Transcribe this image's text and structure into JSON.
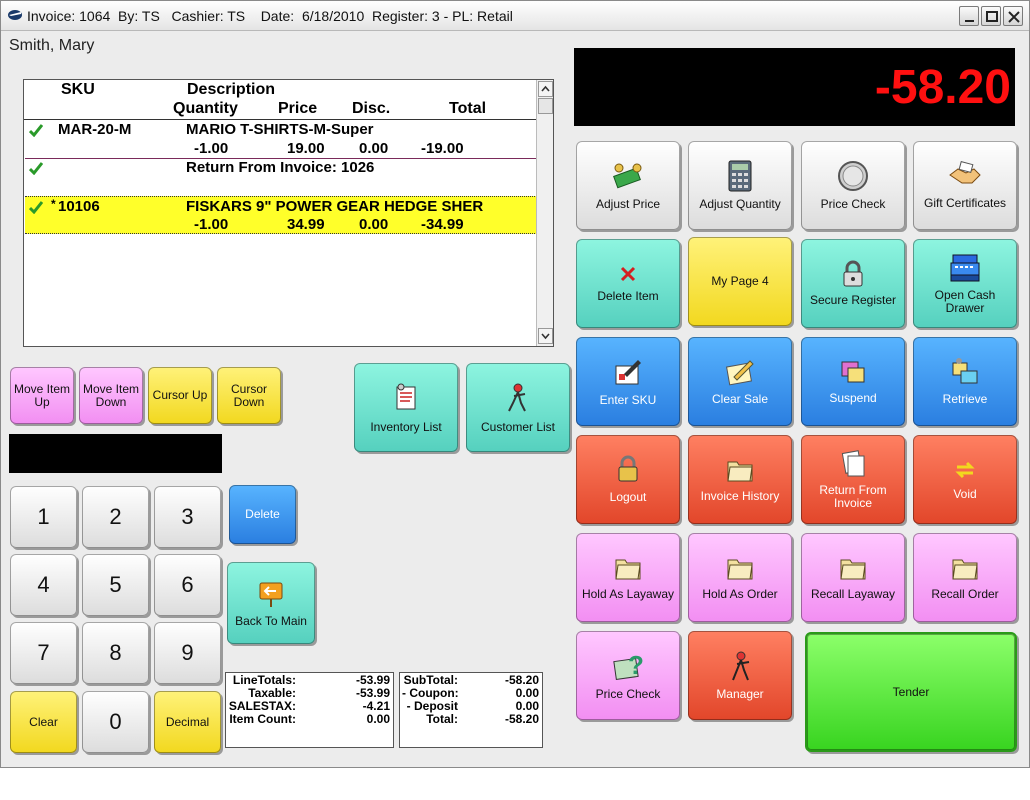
{
  "window": {
    "title": "Invoice: 1064  By: TS   Cashier: TS    Date:  6/18/2010  Register: 3 - PL: Retail"
  },
  "customer": {
    "name": "Smith, Mary"
  },
  "grid": {
    "headers": {
      "sku": "SKU",
      "description": "Description",
      "quantity": "Quantity",
      "price": "Price",
      "disc": "Disc.",
      "total": "Total"
    },
    "rows": [
      {
        "sku": "MAR-20-M",
        "description": "MARIO T-SHIRTS-M-Super",
        "quantity": "-1.00",
        "price": "19.00",
        "disc": "0.00",
        "total": "-19.00"
      },
      {
        "sku": "",
        "description": "Return From Invoice: 1026"
      },
      {
        "marker": "*",
        "sku": "10106",
        "description": "FISKARS 9\" POWER GEAR HEDGE SHER",
        "quantity": "-1.00",
        "price": "34.99",
        "disc": "0.00",
        "total": "-34.99"
      }
    ]
  },
  "display": {
    "amount": "-58.20"
  },
  "nav_buttons": {
    "move_up": "Move Item Up",
    "move_down": "Move Item Down",
    "cursor_up": "Cursor Up",
    "cursor_down": "Cursor Down",
    "inventory_list": "Inventory List",
    "customer_list": "Customer List"
  },
  "keypad": {
    "keys": [
      "1",
      "2",
      "3",
      "4",
      "5",
      "6",
      "7",
      "8",
      "9",
      "0"
    ],
    "clear": "Clear",
    "decimal": "Decimal",
    "delete": "Delete",
    "back_to_main": "Back To Main"
  },
  "function_buttons": {
    "adjust_price": "Adjust Price",
    "adjust_quantity": "Adjust Quantity",
    "price_check": "Price Check",
    "gift_certificates": "Gift Certificates",
    "delete_item": "Delete Item",
    "my_page_4": "My Page 4",
    "secure_register": "Secure Register",
    "open_cash_drawer": "Open Cash Drawer",
    "enter_sku": "Enter SKU",
    "clear_sale": "Clear Sale",
    "suspend": "Suspend",
    "retrieve": "Retrieve",
    "logout": "Logout",
    "invoice_history": "Invoice History",
    "return_from_invoice": "Return From Invoice",
    "void": "Void",
    "hold_as_layaway": "Hold As Layaway",
    "hold_as_order": "Hold As Order",
    "recall_layaway": "Recall Layaway",
    "recall_order": "Recall Order",
    "price_check_2": "Price Check",
    "manager": "Manager",
    "tender": "Tender"
  },
  "totals_left": {
    "line_totals_label": "LineTotals:",
    "line_totals": "-53.99",
    "taxable_label": "Taxable:",
    "taxable": "-53.99",
    "salestax_label": "SALESTAX:",
    "salestax": "-4.21",
    "item_count_label": "Item Count:",
    "item_count": "0.00"
  },
  "totals_right": {
    "subtotal_label": "SubTotal:",
    "subtotal": "-58.20",
    "coupon_label": "- Coupon:",
    "coupon": "0.00",
    "deposit_label": "- Deposit",
    "deposit": "0.00",
    "total_label": "Total:",
    "total": "-58.20"
  },
  "colors": {
    "display_bg": "#000000",
    "display_text": "#ff1010",
    "selected_row": "#ffff2a",
    "teal": "#55d0be",
    "blue": "#2a7ee0",
    "red": "#e2462a",
    "pink": "#f28ef2",
    "yellow": "#f2d81e",
    "green": "#38d420"
  }
}
